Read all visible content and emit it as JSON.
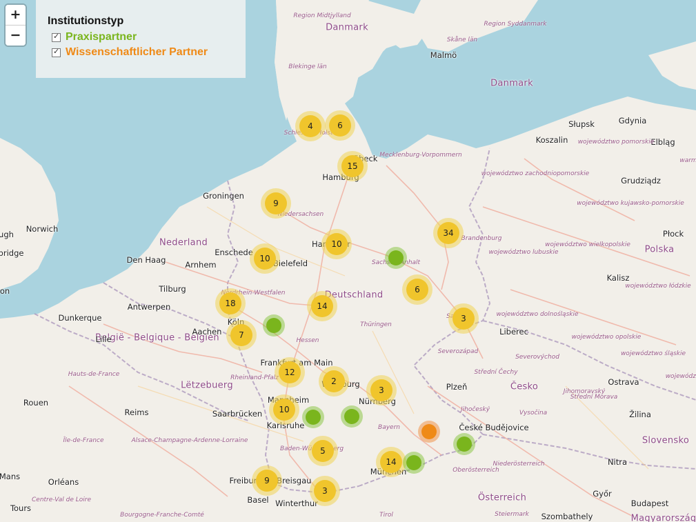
{
  "legend": {
    "title": "Institutionstyp",
    "items": [
      {
        "label": "Praxispartner",
        "color": "#7ab51d",
        "checked": true
      },
      {
        "label": "Wissenschaftlicher Partner",
        "color": "#ef8a17",
        "checked": true
      }
    ]
  },
  "zoom": {
    "in_label": "+",
    "out_label": "−"
  },
  "colors": {
    "water": "#aad3df",
    "land": "#f2efe9",
    "cluster": "#f0c52c",
    "praxis": "#7ab51d",
    "wissenschaft": "#ef8a17"
  },
  "clusters": [
    {
      "count": "4"
    },
    {
      "count": "6"
    },
    {
      "count": "15"
    },
    {
      "count": "9"
    },
    {
      "count": "34"
    },
    {
      "count": "10"
    },
    {
      "count": "10"
    },
    {
      "count": "6"
    },
    {
      "count": "18"
    },
    {
      "count": "14"
    },
    {
      "count": "3"
    },
    {
      "count": "7"
    },
    {
      "count": "12"
    },
    {
      "count": "2"
    },
    {
      "count": "3"
    },
    {
      "count": "10"
    },
    {
      "count": "5"
    },
    {
      "count": "14"
    },
    {
      "count": "9"
    },
    {
      "count": "3"
    }
  ],
  "markers": [
    {
      "type": "praxis"
    },
    {
      "type": "praxis"
    },
    {
      "type": "praxis"
    },
    {
      "type": "praxis"
    },
    {
      "type": "praxis"
    },
    {
      "type": "praxis"
    },
    {
      "type": "wissenschaft"
    }
  ],
  "labels": {
    "countries": [
      "Danmark",
      "Danmark",
      "Nederland",
      "Deutschland",
      "België - Belgique - Belgien",
      "Lëtzebuerg",
      "Polska",
      "Česko",
      "Slovensko",
      "Österreich",
      "Magyarország"
    ],
    "cities": [
      "Malmö",
      "Groningen",
      "Norwich",
      "Den Haag",
      "Enschede",
      "Bielefeld",
      "Hamburg",
      "Hannover",
      "Antwerpen",
      "Tilburg",
      "Arnhem",
      "Dunkerque",
      "Lille",
      "Köln",
      "Aachen",
      "Frankfurt am Main",
      "Würzburg",
      "Nürnberg",
      "Mannheim",
      "Karlsruhe",
      "Saarbrücken",
      "Reims",
      "Rouen",
      "Orléans",
      "Tours",
      "Mans",
      "Basel",
      "Freiburg im Breisgau",
      "Winterthur",
      "München",
      "Plzeň",
      "České Budějovice",
      "Liberec",
      "Słupsk",
      "Gdynia",
      "Koszalin",
      "Elbląg",
      "Grudziądz",
      "Płock",
      "Kalisz",
      "Ostrava",
      "Žilina",
      "Nitra",
      "Győr",
      "Budapest",
      "Szombathely",
      "Lübeck",
      "ugh",
      "bridge",
      "on"
    ],
    "regions": [
      "Region Midtjylland",
      "Region Syddanmark",
      "Blekinge län",
      "Skåne län",
      "Schleswig-Holstein",
      "Mecklenburg-Vorpommern",
      "Niedersachsen",
      "Brandenburg",
      "Sachsen-Anhalt",
      "Nordrhein-Westfalen",
      "Thüringen",
      "Hessen",
      "Rheinland-Pfalz",
      "Bayern",
      "Baden-Württemberg",
      "Sachsen",
      "Hauts-de-France",
      "Alsace-Champagne-Ardenne-Lorraine",
      "Île-de-France",
      "Centre-Val de Loire",
      "Bourgogne-Franche-Comté",
      "Tirol",
      "Steiermark",
      "Oberösterreich",
      "Niederösterreich",
      "Severozápad",
      "Severovýchod",
      "Střední Čechy",
      "Jihočeský",
      "Vysočina",
      "Jihomoravský",
      "Střední Morava",
      "województwo pomorskie",
      "województwo zachodniopomorskie",
      "województwo kujawsko-pomorskie",
      "województwo lubuskie",
      "województwo wielkopolskie",
      "województwo łódzkie",
      "województwo dolnośląskie",
      "województwo opolskie",
      "województwo śląskie",
      "województwo",
      "warm"
    ]
  }
}
